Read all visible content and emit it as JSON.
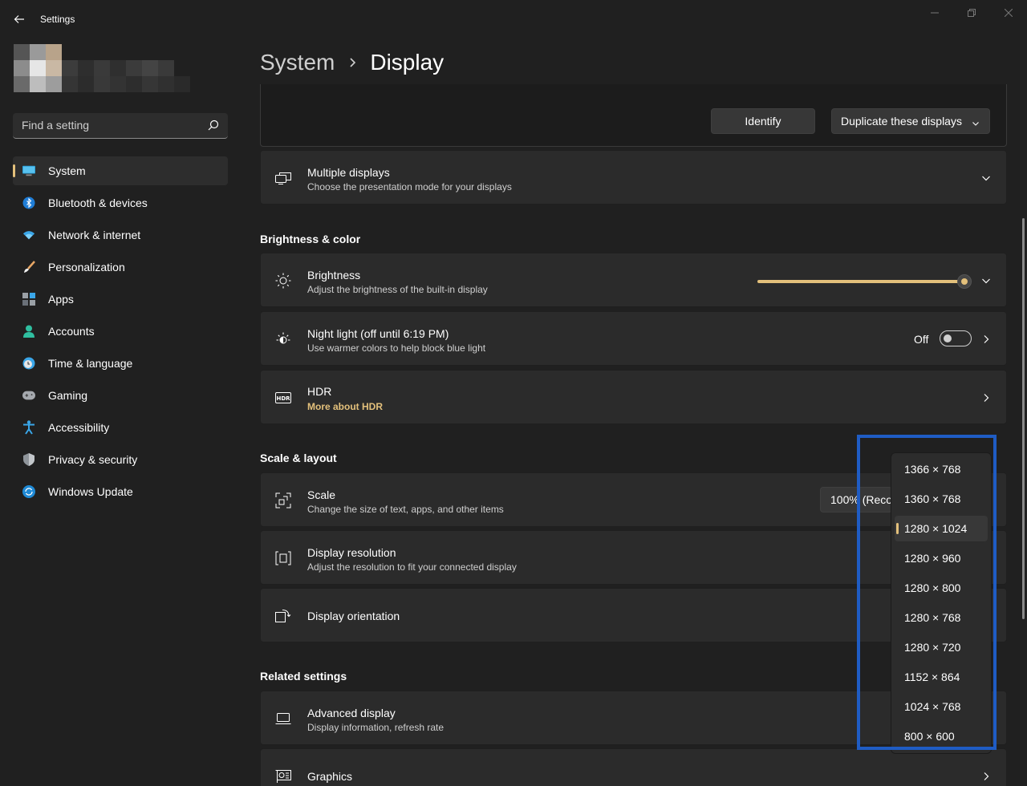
{
  "window": {
    "app_title": "Settings"
  },
  "search": {
    "placeholder": "Find a setting"
  },
  "nav": {
    "items": [
      {
        "label": "System",
        "icon": "monitor-icon"
      },
      {
        "label": "Bluetooth & devices",
        "icon": "bluetooth-icon"
      },
      {
        "label": "Network & internet",
        "icon": "wifi-icon"
      },
      {
        "label": "Personalization",
        "icon": "brush-icon"
      },
      {
        "label": "Apps",
        "icon": "apps-icon"
      },
      {
        "label": "Accounts",
        "icon": "person-icon"
      },
      {
        "label": "Time & language",
        "icon": "clock-globe-icon"
      },
      {
        "label": "Gaming",
        "icon": "gamepad-icon"
      },
      {
        "label": "Accessibility",
        "icon": "accessibility-icon"
      },
      {
        "label": "Privacy & security",
        "icon": "shield-icon"
      },
      {
        "label": "Windows Update",
        "icon": "update-icon"
      }
    ],
    "active": "System"
  },
  "header": {
    "section": "System",
    "page": "Display"
  },
  "display_arrangement": {
    "identify_label": "Identify",
    "mode_label": "Duplicate these displays"
  },
  "multiple_displays": {
    "title": "Multiple displays",
    "subtitle": "Choose the presentation mode for your displays"
  },
  "brightness_color": {
    "heading": "Brightness & color",
    "brightness": {
      "title": "Brightness",
      "subtitle": "Adjust the brightness of the built-in display",
      "level": 1.0
    },
    "night_light": {
      "title": "Night light (off until 6:19 PM)",
      "subtitle": "Use warmer colors to help block blue light",
      "state_label": "Off"
    },
    "hdr": {
      "title": "HDR",
      "link": "More about HDR"
    }
  },
  "scale_layout": {
    "heading": "Scale & layout",
    "scale": {
      "title": "Scale",
      "subtitle": "Change the size of text, apps, and other items",
      "value": "100% (Recor"
    },
    "resolution": {
      "title": "Display resolution",
      "subtitle": "Adjust the resolution to fit your connected display"
    },
    "orientation": {
      "title": "Display orientation"
    }
  },
  "related": {
    "heading": "Related settings",
    "advanced": {
      "title": "Advanced display",
      "subtitle": "Display information, refresh rate"
    },
    "graphics": {
      "title": "Graphics"
    }
  },
  "resolution_dropdown": {
    "options": [
      "1366 × 768",
      "1360 × 768",
      "1280 × 1024",
      "1280 × 960",
      "1280 × 800",
      "1280 × 768",
      "1280 × 720",
      "1152 × 864",
      "1024 × 768",
      "800 × 600"
    ],
    "selected": "1280 × 1024"
  },
  "colors": {
    "accent": "#e3c07b",
    "highlight_box": "#1f5cc4",
    "background": "#202020",
    "card": "#2b2b2b"
  }
}
